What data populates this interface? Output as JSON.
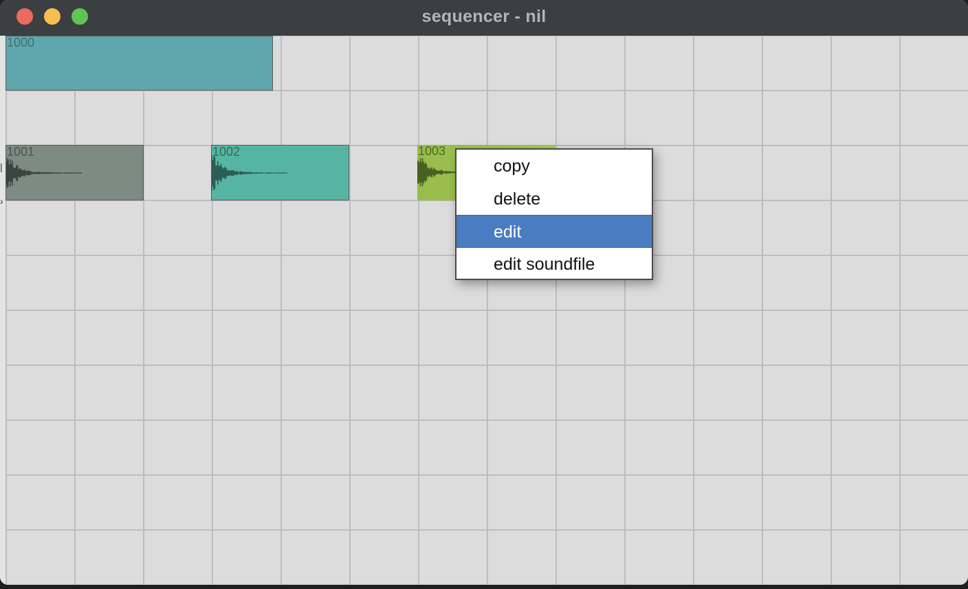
{
  "window": {
    "title": "sequencer - nil"
  },
  "colors": {
    "titlebar": "#3b3f41",
    "canvas": "#dcdcdc",
    "grid": "#bdbdbd",
    "menu_highlight": "#4a7cc1"
  },
  "clips": [
    {
      "label": "1000",
      "color": "#5fa7ad",
      "label_color": "#3d6e74",
      "waveform": false
    },
    {
      "label": "1001",
      "color": "#7d8b84",
      "label_color": "#4b5650",
      "waveform": true,
      "wave_color": "#3c4440"
    },
    {
      "label": "1002",
      "color": "#56b5a2",
      "label_color": "#2f6b5f",
      "waveform": true,
      "wave_color": "#2c5e55"
    },
    {
      "label": "1003",
      "color": "#97bc4c",
      "label_color": "#4c6a22",
      "waveform": true,
      "wave_color": "#47611f"
    }
  ],
  "context_menu": {
    "items": [
      {
        "label": "copy",
        "highlighted": false
      },
      {
        "label": "delete",
        "highlighted": false
      },
      {
        "label": "edit",
        "highlighted": true
      },
      {
        "label": "edit soundfile",
        "highlighted": false
      }
    ]
  },
  "left_edge_marks": [
    "|",
    "›"
  ]
}
